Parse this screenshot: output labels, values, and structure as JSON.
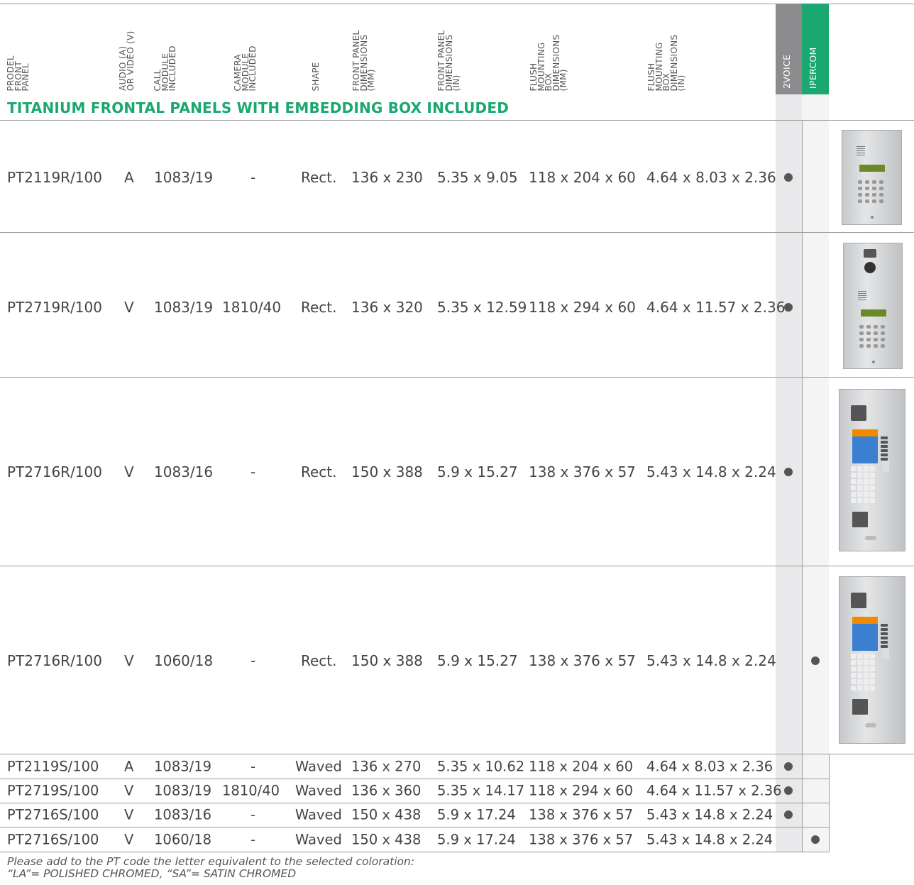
{
  "headers": {
    "model": "PRODEL\nFRONT\nPANEL",
    "audio_video": "AUDIO (A)\nOR VIDEO (V)",
    "call_module": "CALL\nMODULE\nINCLUDED",
    "camera_module": "CAMERA\nMODULE\nINCLUDED",
    "shape": "SHAPE",
    "front_mm": "FRONT PANEL\nDIMENSIONS\n(MM)",
    "front_in": "FRONT PANEL\nDIMENSIONS\n(IN)",
    "box_mm": "FLUSH\nMOUNTING\nBOX\nDIMENSIONS\n(MM)",
    "box_in": "FLUSH\nMOUNTING\nBOX\nDIMENSIONS\n(IN)",
    "brand_2voice": "2VOICE",
    "brand_ipercom": "IPERCOM"
  },
  "section_title": "TITANIUM FRONTAL PANELS WITH EMBEDDING BOX INCLUDED",
  "rows": [
    {
      "model": "PT2119R/100",
      "av": "A",
      "call": "1083/19",
      "camera": "-",
      "shape": "Rect.",
      "front_mm": "136 x 230",
      "front_in": "5.35 x 9.05",
      "box_mm": "118 x 204 x 60",
      "box_in": "4.64 x 8.03 x 2.36",
      "voice": true,
      "ipercom": false,
      "image": "panel-audio-keypad"
    },
    {
      "model": "PT2719R/100",
      "av": "V",
      "call": "1083/19",
      "camera": "1810/40",
      "shape": "Rect.",
      "front_mm": "136 x 320",
      "front_in": "5.35 x 12.59",
      "box_mm": "118 x 294 x 60",
      "box_in": "4.64 x 11.57 x 2.36",
      "voice": true,
      "ipercom": false,
      "image": "panel-video-keypad"
    },
    {
      "model": "PT2716R/100",
      "av": "V",
      "call": "1083/16",
      "camera": "-",
      "shape": "Rect.",
      "front_mm": "150 x 388",
      "front_in": "5.9 x 15.27",
      "box_mm": "138 x 376 x 57",
      "box_in": "5.43 x 14.8 x 2.24",
      "voice": true,
      "ipercom": false,
      "image": "panel-video-display"
    },
    {
      "model": "PT2716R/100",
      "av": "V",
      "call": "1060/18",
      "camera": "-",
      "shape": "Rect.",
      "front_mm": "150 x 388",
      "front_in": "5.9 x 15.27",
      "box_mm": "138 x 376 x 57",
      "box_in": "5.43 x 14.8 x 2.24",
      "voice": false,
      "ipercom": true,
      "image": "panel-video-display"
    },
    {
      "model": "PT2119S/100",
      "av": "A",
      "call": "1083/19",
      "camera": "-",
      "shape": "Waved",
      "front_mm": "136 x 270",
      "front_in": "5.35 x 10.62",
      "box_mm": "118 x 204 x 60",
      "box_in": "4.64 x 8.03 x 2.36",
      "voice": true,
      "ipercom": false
    },
    {
      "model": "PT2719S/100",
      "av": "V",
      "call": "1083/19",
      "camera": "1810/40",
      "shape": "Waved",
      "front_mm": "136 x 360",
      "front_in": "5.35 x 14.17",
      "box_mm": "118 x 294 x 60",
      "box_in": "4.64 x 11.57 x 2.36",
      "voice": true,
      "ipercom": false
    },
    {
      "model": "PT2716S/100",
      "av": "V",
      "call": "1083/16",
      "camera": "-",
      "shape": "Waved",
      "front_mm": "150 x 438",
      "front_in": "5.9 x 17.24",
      "box_mm": "138 x 376 x 57",
      "box_in": "5.43 x 14.8 x 2.24",
      "voice": true,
      "ipercom": false
    },
    {
      "model": "PT2716S/100",
      "av": "V",
      "call": "1060/18",
      "camera": "-",
      "shape": "Waved",
      "front_mm": "150 x 438",
      "front_in": "5.9 x 17.24",
      "box_mm": "138 x 376 x 57",
      "box_in": "5.43 x 14.8 x 2.24",
      "voice": false,
      "ipercom": true
    }
  ],
  "note_line1": "Please add to the PT code the letter equivalent to the selected coloration:",
  "note_line2": "“LA”= POLISHED CHROMED, “SA”= SATIN CHROMED",
  "colors": {
    "accent_green": "#1aa770",
    "voice_grey": "#8c8c8f"
  }
}
